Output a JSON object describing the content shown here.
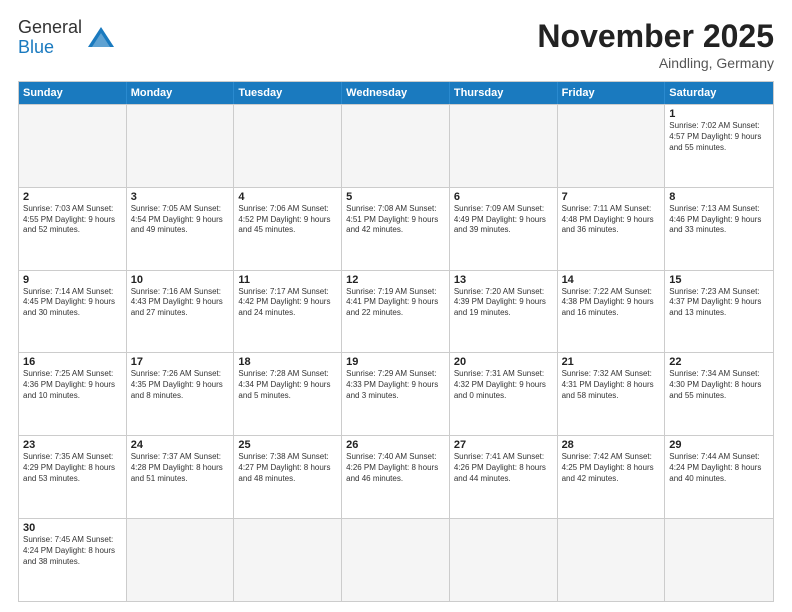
{
  "header": {
    "logo_general": "General",
    "logo_blue": "Blue",
    "month_title": "November 2025",
    "location": "Aindling, Germany"
  },
  "weekdays": [
    "Sunday",
    "Monday",
    "Tuesday",
    "Wednesday",
    "Thursday",
    "Friday",
    "Saturday"
  ],
  "weeks": [
    [
      {
        "date": "",
        "info": ""
      },
      {
        "date": "",
        "info": ""
      },
      {
        "date": "",
        "info": ""
      },
      {
        "date": "",
        "info": ""
      },
      {
        "date": "",
        "info": ""
      },
      {
        "date": "",
        "info": ""
      },
      {
        "date": "1",
        "info": "Sunrise: 7:02 AM\nSunset: 4:57 PM\nDaylight: 9 hours and 55 minutes."
      }
    ],
    [
      {
        "date": "2",
        "info": "Sunrise: 7:03 AM\nSunset: 4:55 PM\nDaylight: 9 hours and 52 minutes."
      },
      {
        "date": "3",
        "info": "Sunrise: 7:05 AM\nSunset: 4:54 PM\nDaylight: 9 hours and 49 minutes."
      },
      {
        "date": "4",
        "info": "Sunrise: 7:06 AM\nSunset: 4:52 PM\nDaylight: 9 hours and 45 minutes."
      },
      {
        "date": "5",
        "info": "Sunrise: 7:08 AM\nSunset: 4:51 PM\nDaylight: 9 hours and 42 minutes."
      },
      {
        "date": "6",
        "info": "Sunrise: 7:09 AM\nSunset: 4:49 PM\nDaylight: 9 hours and 39 minutes."
      },
      {
        "date": "7",
        "info": "Sunrise: 7:11 AM\nSunset: 4:48 PM\nDaylight: 9 hours and 36 minutes."
      },
      {
        "date": "8",
        "info": "Sunrise: 7:13 AM\nSunset: 4:46 PM\nDaylight: 9 hours and 33 minutes."
      }
    ],
    [
      {
        "date": "9",
        "info": "Sunrise: 7:14 AM\nSunset: 4:45 PM\nDaylight: 9 hours and 30 minutes."
      },
      {
        "date": "10",
        "info": "Sunrise: 7:16 AM\nSunset: 4:43 PM\nDaylight: 9 hours and 27 minutes."
      },
      {
        "date": "11",
        "info": "Sunrise: 7:17 AM\nSunset: 4:42 PM\nDaylight: 9 hours and 24 minutes."
      },
      {
        "date": "12",
        "info": "Sunrise: 7:19 AM\nSunset: 4:41 PM\nDaylight: 9 hours and 22 minutes."
      },
      {
        "date": "13",
        "info": "Sunrise: 7:20 AM\nSunset: 4:39 PM\nDaylight: 9 hours and 19 minutes."
      },
      {
        "date": "14",
        "info": "Sunrise: 7:22 AM\nSunset: 4:38 PM\nDaylight: 9 hours and 16 minutes."
      },
      {
        "date": "15",
        "info": "Sunrise: 7:23 AM\nSunset: 4:37 PM\nDaylight: 9 hours and 13 minutes."
      }
    ],
    [
      {
        "date": "16",
        "info": "Sunrise: 7:25 AM\nSunset: 4:36 PM\nDaylight: 9 hours and 10 minutes."
      },
      {
        "date": "17",
        "info": "Sunrise: 7:26 AM\nSunset: 4:35 PM\nDaylight: 9 hours and 8 minutes."
      },
      {
        "date": "18",
        "info": "Sunrise: 7:28 AM\nSunset: 4:34 PM\nDaylight: 9 hours and 5 minutes."
      },
      {
        "date": "19",
        "info": "Sunrise: 7:29 AM\nSunset: 4:33 PM\nDaylight: 9 hours and 3 minutes."
      },
      {
        "date": "20",
        "info": "Sunrise: 7:31 AM\nSunset: 4:32 PM\nDaylight: 9 hours and 0 minutes."
      },
      {
        "date": "21",
        "info": "Sunrise: 7:32 AM\nSunset: 4:31 PM\nDaylight: 8 hours and 58 minutes."
      },
      {
        "date": "22",
        "info": "Sunrise: 7:34 AM\nSunset: 4:30 PM\nDaylight: 8 hours and 55 minutes."
      }
    ],
    [
      {
        "date": "23",
        "info": "Sunrise: 7:35 AM\nSunset: 4:29 PM\nDaylight: 8 hours and 53 minutes."
      },
      {
        "date": "24",
        "info": "Sunrise: 7:37 AM\nSunset: 4:28 PM\nDaylight: 8 hours and 51 minutes."
      },
      {
        "date": "25",
        "info": "Sunrise: 7:38 AM\nSunset: 4:27 PM\nDaylight: 8 hours and 48 minutes."
      },
      {
        "date": "26",
        "info": "Sunrise: 7:40 AM\nSunset: 4:26 PM\nDaylight: 8 hours and 46 minutes."
      },
      {
        "date": "27",
        "info": "Sunrise: 7:41 AM\nSunset: 4:26 PM\nDaylight: 8 hours and 44 minutes."
      },
      {
        "date": "28",
        "info": "Sunrise: 7:42 AM\nSunset: 4:25 PM\nDaylight: 8 hours and 42 minutes."
      },
      {
        "date": "29",
        "info": "Sunrise: 7:44 AM\nSunset: 4:24 PM\nDaylight: 8 hours and 40 minutes."
      }
    ],
    [
      {
        "date": "30",
        "info": "Sunrise: 7:45 AM\nSunset: 4:24 PM\nDaylight: 8 hours and 38 minutes."
      },
      {
        "date": "",
        "info": ""
      },
      {
        "date": "",
        "info": ""
      },
      {
        "date": "",
        "info": ""
      },
      {
        "date": "",
        "info": ""
      },
      {
        "date": "",
        "info": ""
      },
      {
        "date": "",
        "info": ""
      }
    ]
  ]
}
